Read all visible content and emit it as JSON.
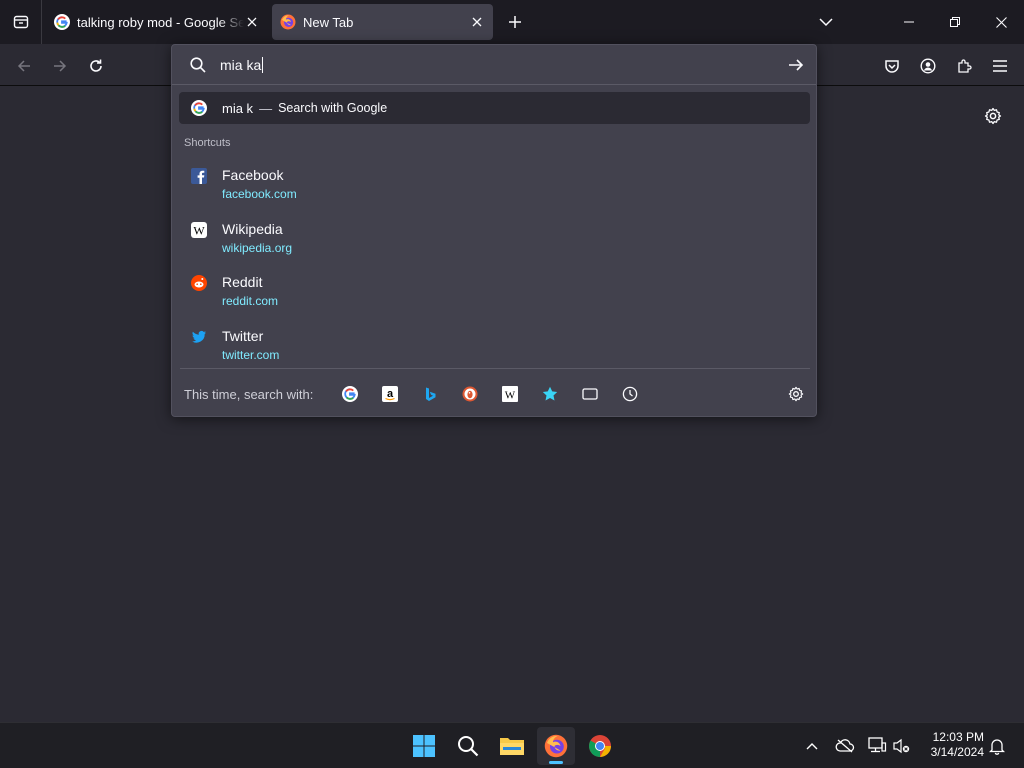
{
  "tabs": [
    {
      "title": "talking roby mod - Google Search",
      "favicon": "google-icon",
      "active": false
    },
    {
      "title": "New Tab",
      "favicon": "firefox-icon",
      "active": true
    }
  ],
  "urlbar": {
    "value": "mia ka",
    "suggestion": {
      "text": "mia k",
      "separator": "—",
      "action": "Search with Google"
    }
  },
  "shortcuts": {
    "heading": "Shortcuts",
    "items": [
      {
        "name": "Facebook",
        "url": "facebook.com",
        "icon": "facebook-icon"
      },
      {
        "name": "Wikipedia",
        "url": "wikipedia.org",
        "icon": "wikipedia-icon"
      },
      {
        "name": "Reddit",
        "url": "reddit.com",
        "icon": "reddit-icon"
      },
      {
        "name": "Twitter",
        "url": "twitter.com",
        "icon": "twitter-icon"
      }
    ]
  },
  "search_with": {
    "label": "This time, search with:",
    "engines": [
      "google-icon",
      "amazon-icon",
      "bing-icon",
      "duckduckgo-icon",
      "wikipedia-icon",
      "bookmarks-icon",
      "tabs-icon",
      "history-icon"
    ]
  },
  "clock": {
    "time": "12:03 PM",
    "date": "3/14/2024"
  },
  "colors": {
    "accent_link": "#80ebff",
    "panel": "#42414d",
    "background": "#2b2a33"
  }
}
